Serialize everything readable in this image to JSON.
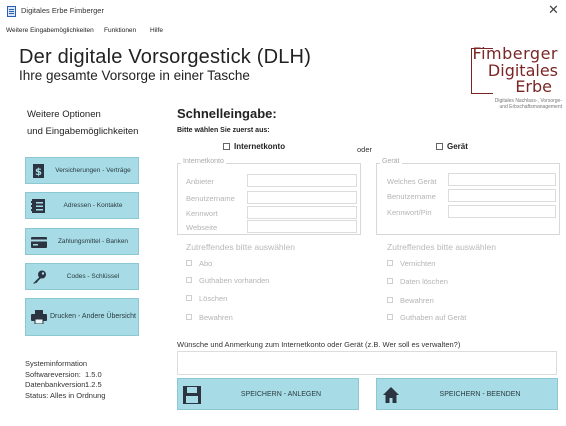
{
  "window": {
    "title": "Digitales Erbe Fimberger",
    "close_symbol": "✕"
  },
  "menu": {
    "items": [
      {
        "label": "Weitere Eingabemöglichkeiten"
      },
      {
        "label": "Funktionen"
      },
      {
        "label": "Hilfe"
      }
    ]
  },
  "header": {
    "title": "Der digitale Vorsorgestick (DLH)",
    "subtitle": "Ihre gesamte Vorsorge in einer Tasche"
  },
  "logo": {
    "line1": "Fimberger",
    "line2": "Digitales",
    "line3": "Erbe",
    "tagline1": "Digitales Nachlass-, Vorsorge-",
    "tagline2": "und Erbschaftsmanagement"
  },
  "sidebar": {
    "title_line1": "Weitere Optionen",
    "title_line2": "und Eingabemöglichkeiten",
    "buttons": [
      {
        "label": "Versicherungen - Verträge",
        "icon": "dollar-document-icon"
      },
      {
        "label": "Adressen - Kontakte",
        "icon": "address-book-icon"
      },
      {
        "label": "Zahlungsmittel - Banken",
        "icon": "credit-card-icon"
      },
      {
        "label": "Codes - Schlüssel",
        "icon": "key-icon"
      },
      {
        "label": "Drucken - Andere Übersicht",
        "icon": "printer-icon"
      }
    ]
  },
  "sysinfo": {
    "heading": "Systeminformation",
    "software_label": "Softwareversion:",
    "software_value": "1.5.0",
    "db_label": "Datenbankversion:",
    "db_value": "1.2.5",
    "status": "Status: Alles in Ordnung"
  },
  "quick": {
    "title": "Schnelleingabe:",
    "choose": "Bitte wählen Sie zuerst aus:",
    "option_internet": "Internetkonto",
    "or": "oder",
    "option_device": "Gerät"
  },
  "internet_group": {
    "title": "Internetkonto",
    "fields": [
      {
        "label": "Anbieter",
        "value": ""
      },
      {
        "label": "Benutzername",
        "value": ""
      },
      {
        "label": "Kennwort",
        "value": ""
      },
      {
        "label": "Webseite",
        "value": ""
      }
    ],
    "sub_head": "Zutreffendes bitte auswählen",
    "checks": [
      {
        "label": "Abo"
      },
      {
        "label": "Guthaben vorhanden"
      },
      {
        "label": "Löschen"
      },
      {
        "label": "Bewahren"
      }
    ]
  },
  "device_group": {
    "title": "Gerät",
    "fields": [
      {
        "label": "Welches Gerät",
        "value": ""
      },
      {
        "label": "Benutzername",
        "value": ""
      },
      {
        "label": "Kennwort/Pin",
        "value": ""
      }
    ],
    "sub_head": "Zutreffendes bitte auswählen",
    "checks": [
      {
        "label": "Vernichten"
      },
      {
        "label": "Daten löschen"
      },
      {
        "label": "Bewahren"
      },
      {
        "label": "Guthaben auf Gerät"
      }
    ]
  },
  "wish": {
    "label": "Wünsche und Anmerkung zum Internetkonto oder Gerät (z.B. Wer soll es verwalten?)",
    "value": ""
  },
  "actions": {
    "save_new": "SPEICHERN - ANLEGEN",
    "save_exit": "SPEICHERN - BEENDEN"
  },
  "colors": {
    "button_bg": "#a7dce6",
    "logo": "#7a2626"
  }
}
